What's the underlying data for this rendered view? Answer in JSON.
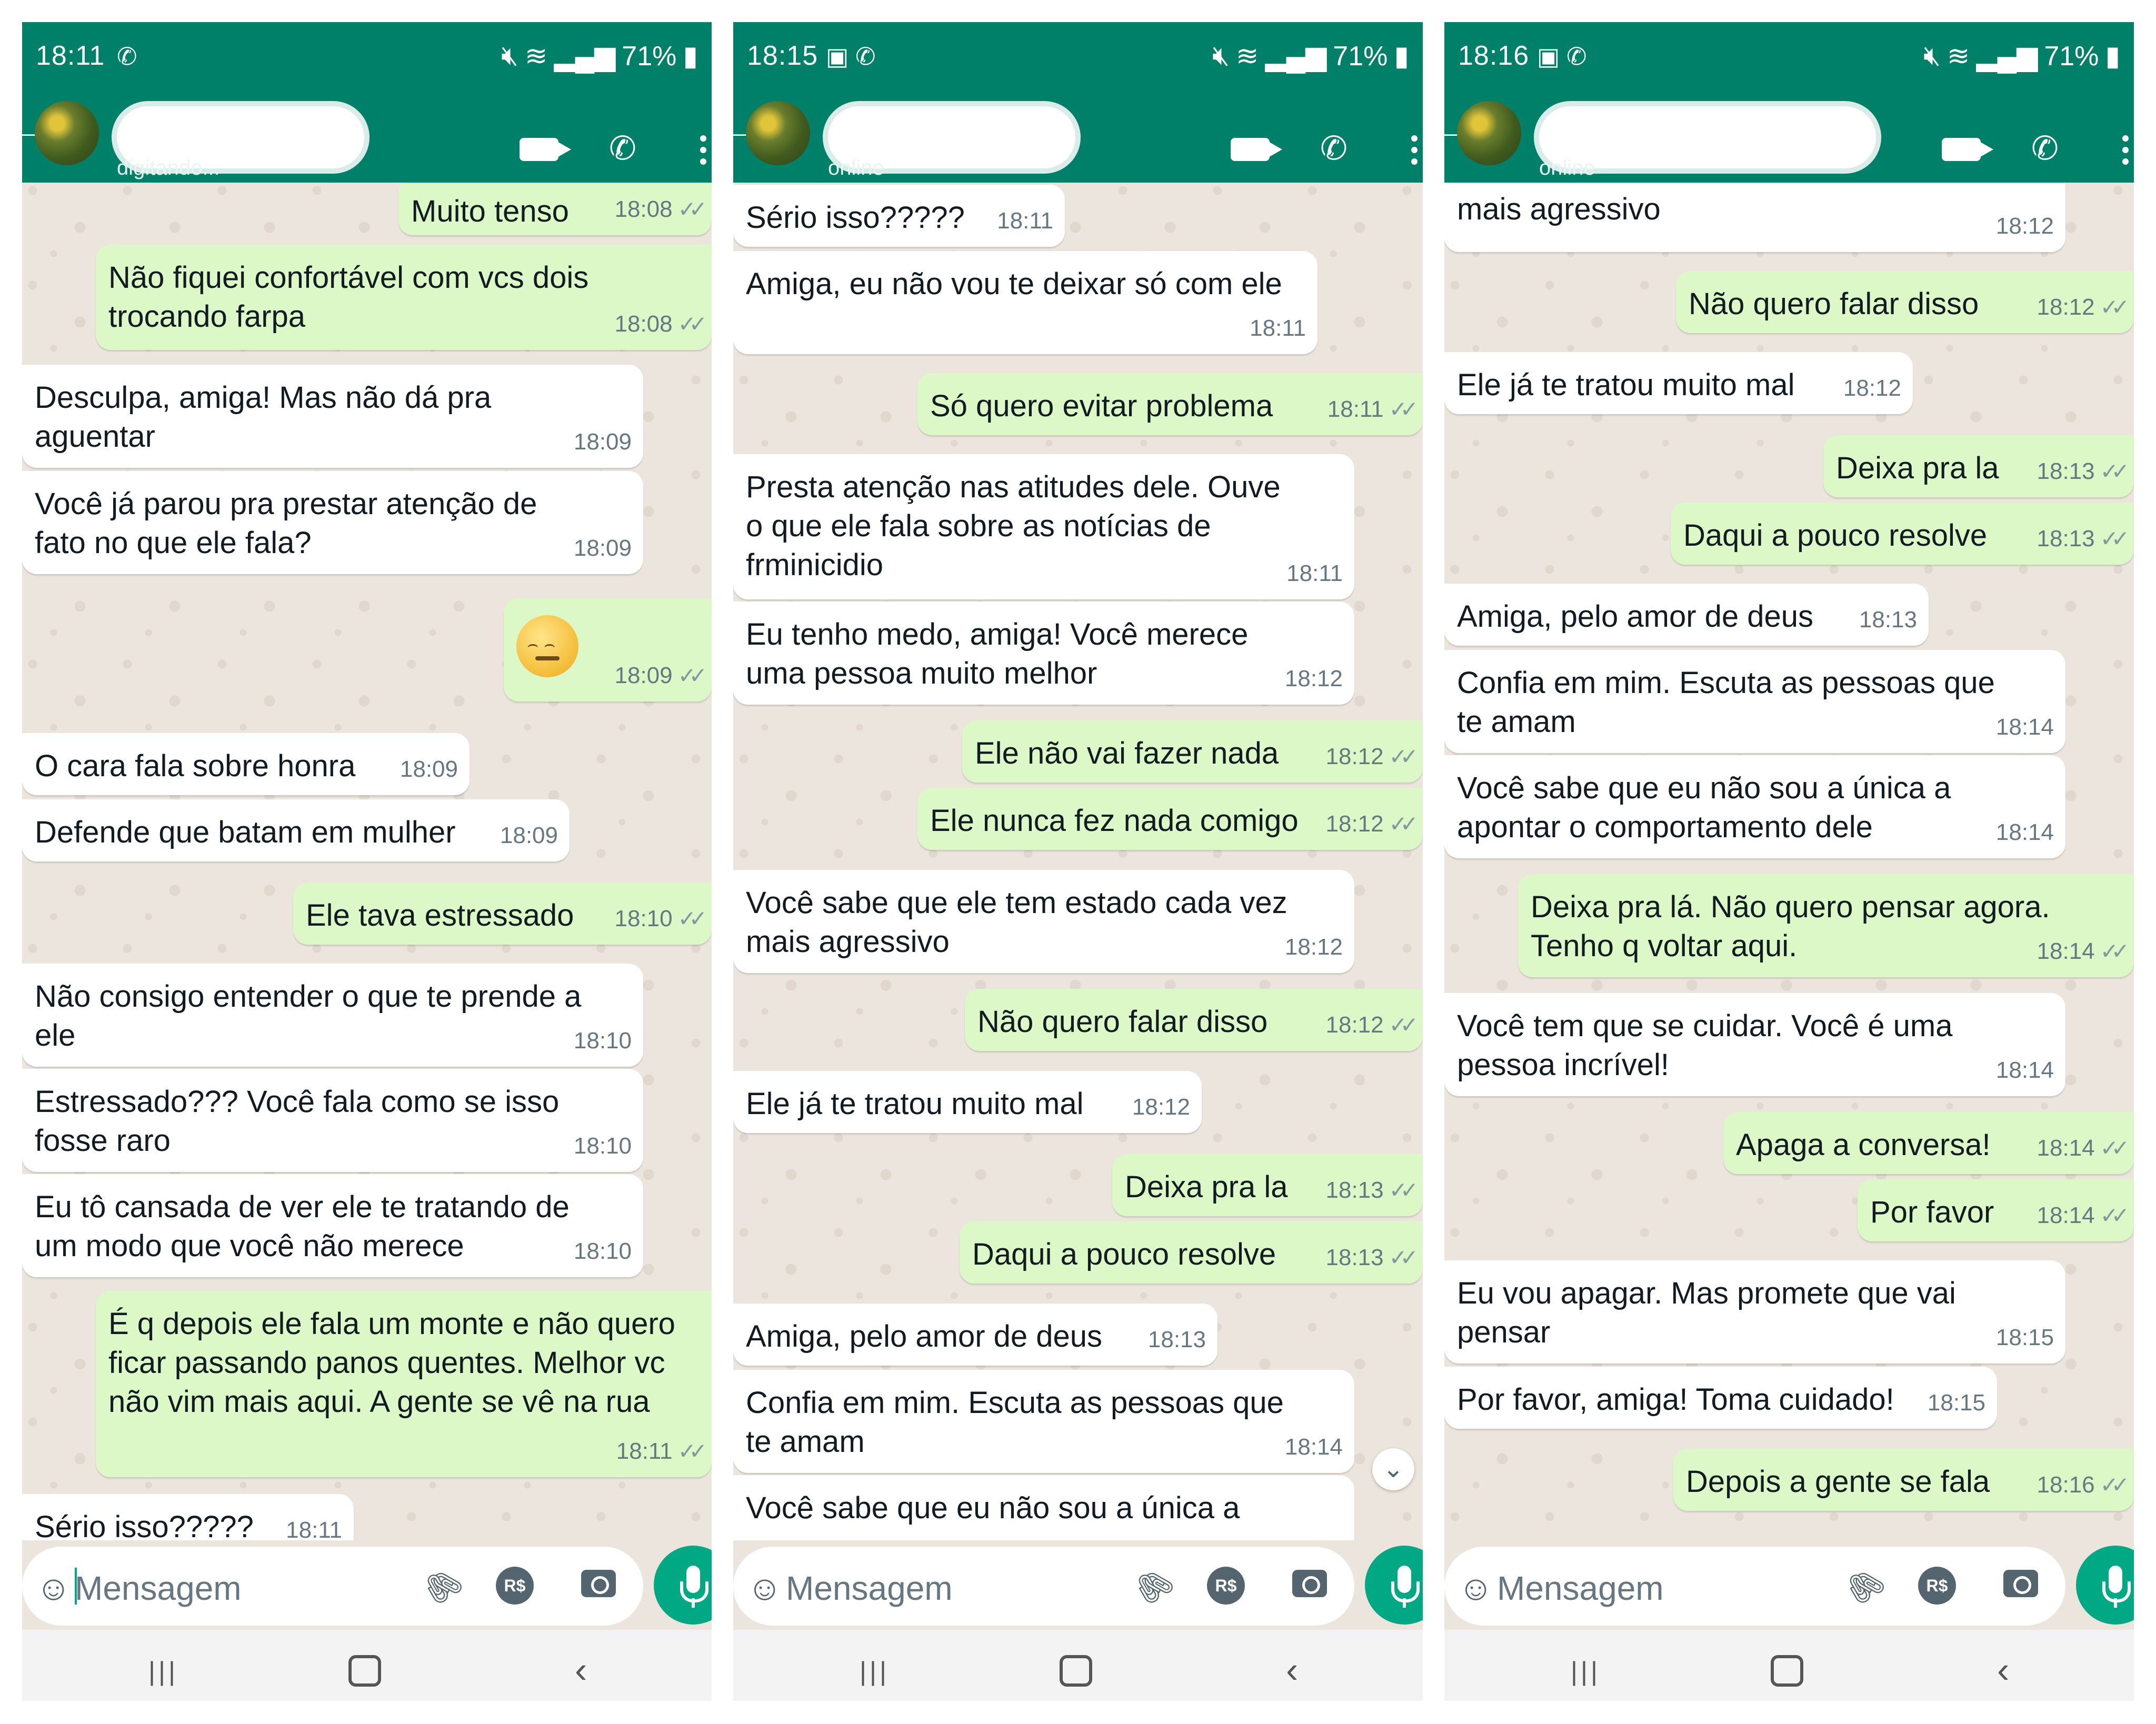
{
  "panels": [
    {
      "status_time": "18:11",
      "battery": "71%",
      "contact_status": "digitando...",
      "input_placeholder": "Mensagem",
      "pix_label": "R$",
      "messages": [
        {
          "text": "Muito tenso",
          "time": "18:08"
        },
        {
          "text": "Não fiquei confortável com vcs dois trocando farpa",
          "time": "18:08"
        },
        {
          "text": "Desculpa, amiga! Mas não dá pra aguentar",
          "time": "18:09"
        },
        {
          "text": "Você já parou pra prestar atenção de fato no que ele fala?",
          "time": "18:09"
        },
        {
          "text": "",
          "time": "18:09"
        },
        {
          "text": "O cara fala sobre honra",
          "time": "18:09"
        },
        {
          "text": "Defende que batam em mulher",
          "time": "18:09"
        },
        {
          "text": "Ele tava estressado",
          "time": "18:10"
        },
        {
          "text": "Não consigo entender o que te prende a ele",
          "time": "18:10"
        },
        {
          "text": "Estressado??? Você fala como se isso fosse raro",
          "time": "18:10"
        },
        {
          "text": "Eu tô cansada de ver ele te tratando de um modo que você não merece",
          "time": "18:10"
        },
        {
          "text": "É q depois ele fala um monte e não quero ficar passando panos quentes. Melhor vc não vim mais aqui. A gente se vê na rua",
          "time": "18:11"
        },
        {
          "text": "Sério isso?????",
          "time": "18:11"
        }
      ]
    },
    {
      "status_time": "18:15",
      "battery": "71%",
      "contact_status": "online",
      "input_placeholder": "Mensagem",
      "pix_label": "R$",
      "messages": [
        {
          "text": "Sério isso?????",
          "time": "18:11"
        },
        {
          "text": "Amiga, eu não vou te deixar só com ele",
          "time": "18:11"
        },
        {
          "text": "Só quero evitar problema",
          "time": "18:11"
        },
        {
          "text": "Presta atenção nas atitudes dele. Ouve o que ele fala sobre as notícias de frminicidio",
          "time": "18:11"
        },
        {
          "text": "Eu tenho medo, amiga! Você merece uma pessoa muito melhor",
          "time": "18:12"
        },
        {
          "text": "Ele não vai fazer nada",
          "time": "18:12"
        },
        {
          "text": "Ele nunca fez nada comigo",
          "time": "18:12"
        },
        {
          "text": "Você sabe que ele tem estado cada vez mais agressivo",
          "time": "18:12"
        },
        {
          "text": "Não quero falar disso",
          "time": "18:12"
        },
        {
          "text": "Ele já te tratou muito mal",
          "time": "18:12"
        },
        {
          "text": "Deixa pra la",
          "time": "18:13"
        },
        {
          "text": "Daqui a pouco resolve",
          "time": "18:13"
        },
        {
          "text": "Amiga, pelo amor de deus",
          "time": "18:13"
        },
        {
          "text": "Confia em mim. Escuta as pessoas que te amam",
          "time": "18:14"
        },
        {
          "text": "Você sabe que eu não sou a única a",
          "time": ""
        }
      ]
    },
    {
      "status_time": "18:16",
      "battery": "71%",
      "contact_status": "online",
      "input_placeholder": "Mensagem",
      "pix_label": "R$",
      "messages": [
        {
          "text": "mais agressivo",
          "time": "18:12"
        },
        {
          "text": "Não quero falar disso",
          "time": "18:12"
        },
        {
          "text": "Ele já te tratou muito mal",
          "time": "18:12"
        },
        {
          "text": "Deixa pra la",
          "time": "18:13"
        },
        {
          "text": "Daqui a pouco resolve",
          "time": "18:13"
        },
        {
          "text": "Amiga, pelo amor de deus",
          "time": "18:13"
        },
        {
          "text": "Confia em mim. Escuta as pessoas que te amam",
          "time": "18:14"
        },
        {
          "text": "Você sabe que eu não sou a única a apontar o comportamento dele",
          "time": "18:14"
        },
        {
          "text": "Deixa pra lá. Não quero pensar agora. Tenho q voltar aqui.",
          "time": "18:14"
        },
        {
          "text": "Você tem que se cuidar. Você é uma pessoa incrível!",
          "time": "18:14"
        },
        {
          "text": "Apaga a conversa!",
          "time": "18:14"
        },
        {
          "text": "Por favor",
          "time": "18:14"
        },
        {
          "text": "Eu vou apagar. Mas promete que vai pensar",
          "time": "18:15"
        },
        {
          "text": "Por favor, amiga! Toma cuidado!",
          "time": "18:15"
        },
        {
          "text": "Depois a gente se fala",
          "time": "18:16"
        }
      ]
    }
  ],
  "colors": {
    "header": "#008069",
    "outgoing_bubble": "#dcf8c6",
    "incoming_bubble": "#ffffff",
    "chat_background": "#ece5dd",
    "accent": "#00a884"
  },
  "icons": [
    "whatsapp-icon",
    "gallery-icon",
    "mute-icon",
    "wifi-icon",
    "signal-icon",
    "battery-icon",
    "video-call-icon",
    "phone-icon",
    "menu-icon",
    "emoji-icon",
    "attach-icon",
    "pix-icon",
    "camera-icon",
    "mic-icon",
    "recents-icon",
    "home-icon",
    "back-icon",
    "scroll-down-icon"
  ]
}
